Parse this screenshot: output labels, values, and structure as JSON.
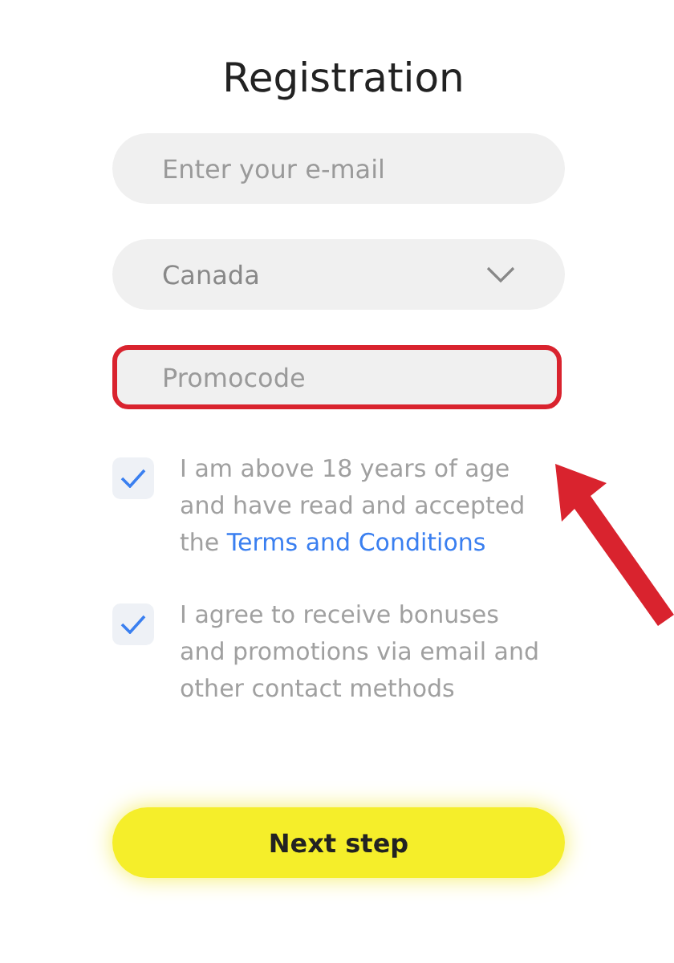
{
  "title": "Registration",
  "fields": [
    {
      "kind": "input",
      "placeholder": "Enter your e-mail",
      "highlighted": false
    },
    {
      "kind": "select",
      "value": "Canada",
      "highlighted": false
    },
    {
      "kind": "input",
      "placeholder": "Promocode",
      "highlighted": true
    }
  ],
  "checkboxes": [
    {
      "checked": true,
      "text": "I am above 18 years of age and have read and accepted the ",
      "link": "Terms and Conditions"
    },
    {
      "checked": true,
      "text": "I agree to receive bonuses and promotions via email and other contact methods"
    }
  ],
  "button": "Next step",
  "annotation_arrow": true
}
